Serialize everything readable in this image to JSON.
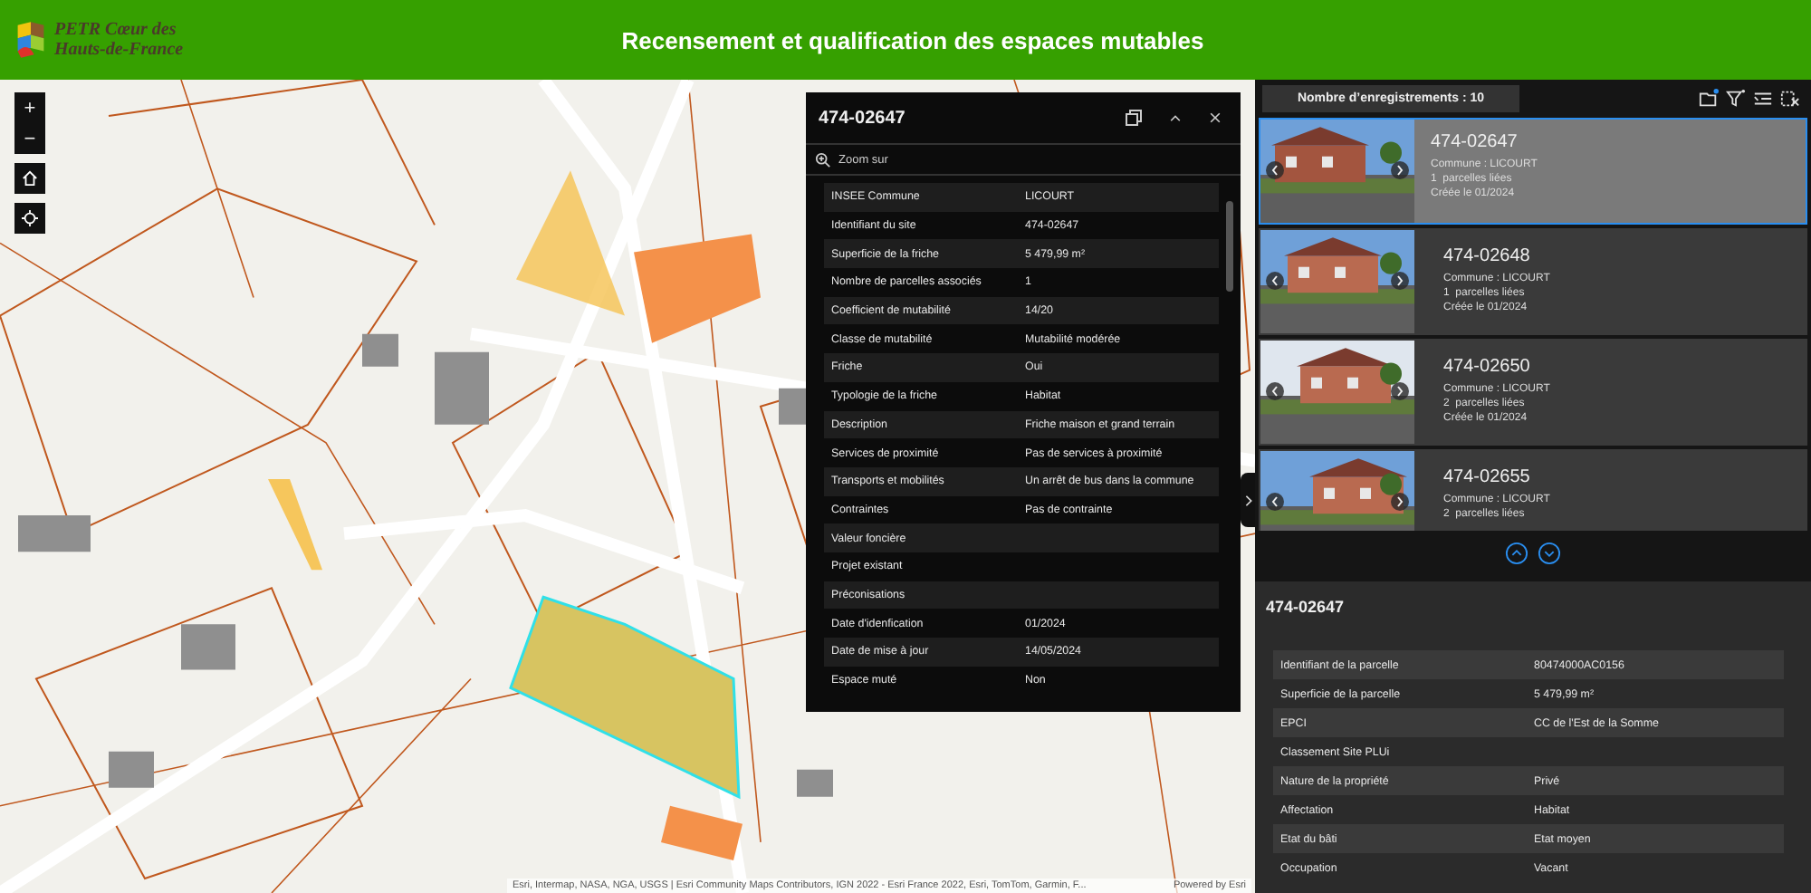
{
  "header": {
    "logo_line1": "PETR Cœur des",
    "logo_line2": "Hauts-de-France",
    "title": "Recensement et qualification des espaces mutables"
  },
  "map": {
    "zoom_in": "+",
    "zoom_out": "−",
    "attribution": "Esri, Intermap, NASA, NGA, USGS | Esri Community Maps Contributors, IGN 2022 - Esri France 2022, Esri, TomTom, Garmin, F...",
    "powered_by": "Powered by Esri"
  },
  "popup": {
    "title": "474-02647",
    "zoom_label": "Zoom sur",
    "rows": [
      {
        "label": "INSEE Commune",
        "value": "LICOURT"
      },
      {
        "label": "Identifiant du site",
        "value": "474-02647"
      },
      {
        "label": "Superficie de la friche",
        "value": "5 479,99 m²"
      },
      {
        "label": "Nombre de parcelles associés",
        "value": "1"
      },
      {
        "label": "Coefficient de mutabilité",
        "value": "14/20"
      },
      {
        "label": "Classe de mutabilité",
        "value": "Mutabilité modérée"
      },
      {
        "label": "Friche",
        "value": "Oui"
      },
      {
        "label": "Typologie de la friche",
        "value": "Habitat"
      },
      {
        "label": "Description",
        "value": "Friche maison et grand terrain"
      },
      {
        "label": "Services de proximité",
        "value": "Pas de services à proximité"
      },
      {
        "label": "Transports et mobilités",
        "value": "Un arrêt de bus dans la commune"
      },
      {
        "label": "Contraintes",
        "value": "Pas de contrainte"
      },
      {
        "label": "Valeur foncière"
      },
      {
        "label": "Projet existant"
      },
      {
        "label": "Préconisations"
      },
      {
        "label": "Date d'idenfication",
        "value": "01/2024"
      },
      {
        "label": "Date de mise à jour",
        "value": "14/05/2024"
      },
      {
        "label": "Espace muté",
        "value": "Non"
      }
    ]
  },
  "list": {
    "count": "Nombre d’enregistrements : 10",
    "cards": [
      {
        "id": "474-02647",
        "commune": "Commune : LICOURT",
        "parcels": "1  parcelles liées",
        "created": "Créée le 01/2024",
        "selected": true
      },
      {
        "id": "474-02648",
        "commune": "Commune : LICOURT",
        "parcels": "1  parcelles liées",
        "created": "Créée le 01/2024",
        "selected": false
      },
      {
        "id": "474-02650",
        "commune": "Commune : LICOURT",
        "parcels": "2  parcelles liées",
        "created": "Créée le 01/2024",
        "selected": false
      },
      {
        "id": "474-02655",
        "commune": "Commune : LICOURT",
        "parcels": "2  parcelles liées",
        "selected": false
      }
    ]
  },
  "detail": {
    "title": "474-02647",
    "rows": [
      {
        "label": "Identifiant de la parcelle",
        "value": "80474000AC0156"
      },
      {
        "label": "Superficie de la parcelle",
        "value": "5 479,99 m²"
      },
      {
        "label": "EPCI",
        "value": "CC de l'Est de la Somme"
      },
      {
        "label": "Classement Site PLUi"
      },
      {
        "label": "Nature de la propriété",
        "value": "Privé"
      },
      {
        "label": "Affectation",
        "value": "Habitat"
      },
      {
        "label": "Etat du bâti",
        "value": "Etat moyen"
      },
      {
        "label": "Occupation",
        "value": "Vacant"
      }
    ]
  }
}
